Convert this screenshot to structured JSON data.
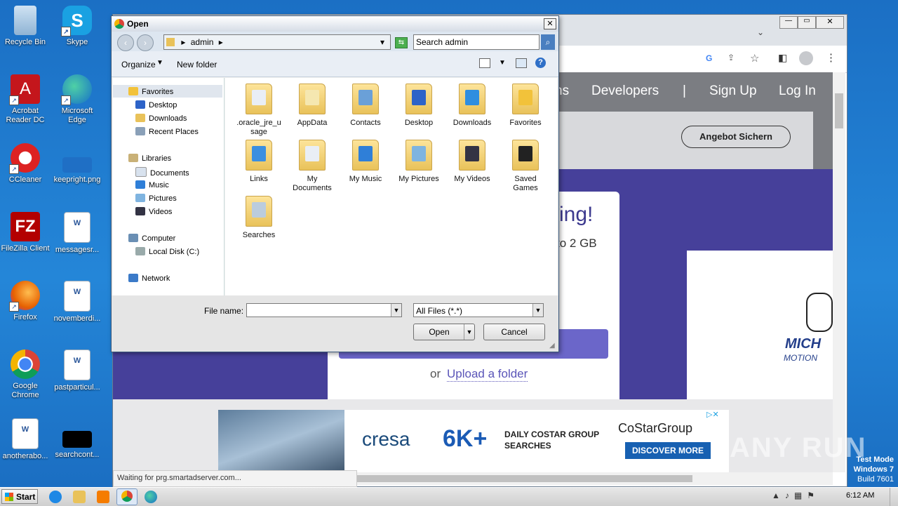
{
  "desktop": {
    "icons": [
      {
        "label": "Recycle Bin"
      },
      {
        "label": "Skype"
      },
      {
        "label": "Acrobat Reader DC"
      },
      {
        "label": "Microsoft Edge"
      },
      {
        "label": "CCleaner"
      },
      {
        "label": "keepright.png"
      },
      {
        "label": "FileZilla Client"
      },
      {
        "label": "messagesr..."
      },
      {
        "label": "Firefox"
      },
      {
        "label": "novemberdi..."
      },
      {
        "label": "Google Chrome"
      },
      {
        "label": "pastparticul..."
      },
      {
        "label": "anotherabo..."
      },
      {
        "label": "searchcont..."
      }
    ],
    "watermark": "ANY RUN",
    "test_mode": {
      "line1": "Test Mode",
      "line2": "Windows 7",
      "line3": "Build 7601"
    }
  },
  "browser": {
    "nav": {
      "partial": "ns",
      "developers": "Developers",
      "divider": "|",
      "signup": "Sign Up",
      "login": "Log In"
    },
    "cta_button": "Angebot Sichern",
    "hero_heading_partial": "ring!",
    "hero_sub_partial": "to 2 GB",
    "upload_or": "or",
    "upload_folder": "Upload a folder",
    "right_ad_text": "MICH",
    "right_ad_text2": "MOTION",
    "banner": {
      "brand": "cresa",
      "big": "6K+",
      "line1": "DAILY COSTAR GROUP",
      "line2": "SEARCHES",
      "costar": "CoStarGroup",
      "cta": "DISCOVER MORE"
    },
    "status": "Waiting for prg.smartadserver.com..."
  },
  "dialog": {
    "title": "Open",
    "breadcrumb": "admin",
    "search_placeholder": "Search admin",
    "organize": "Organize",
    "new_folder": "New folder",
    "nav": {
      "favorites": "Favorites",
      "desktop": "Desktop",
      "downloads": "Downloads",
      "recent": "Recent Places",
      "libraries": "Libraries",
      "documents": "Documents",
      "music": "Music",
      "pictures": "Pictures",
      "videos": "Videos",
      "computer": "Computer",
      "localdisk": "Local Disk (C:)",
      "network": "Network"
    },
    "folders": [
      {
        "line1": ".oracle_jre_u",
        "line2": "sage",
        "color": "#e9eef5"
      },
      {
        "line1": "AppData",
        "line2": "",
        "color": "#f5e7b0"
      },
      {
        "line1": "Contacts",
        "line2": "",
        "color": "#6aa0d8"
      },
      {
        "line1": "Desktop",
        "line2": "",
        "color": "#2d63c8"
      },
      {
        "line1": "Downloads",
        "line2": "",
        "color": "#2f8ee0"
      },
      {
        "line1": "Favorites",
        "line2": "",
        "color": "#f2c23a"
      },
      {
        "line1": "Links",
        "line2": "",
        "color": "#3b8fe0"
      },
      {
        "line1": "My",
        "line2": "Documents",
        "color": "#e9eef5"
      },
      {
        "line1": "My Music",
        "line2": "",
        "color": "#2f7fd8"
      },
      {
        "line1": "My Pictures",
        "line2": "",
        "color": "#7fb4e0"
      },
      {
        "line1": "My Videos",
        "line2": "",
        "color": "#334"
      },
      {
        "line1": "Saved",
        "line2": "Games",
        "color": "#222"
      },
      {
        "line1": "Searches",
        "line2": "",
        "color": "#bcd"
      }
    ],
    "file_name_label": "File name:",
    "file_name_value": "",
    "filter": "All Files (*.*)",
    "open": "Open",
    "cancel": "Cancel"
  },
  "taskbar": {
    "start": "Start",
    "time": "6:12 AM"
  }
}
